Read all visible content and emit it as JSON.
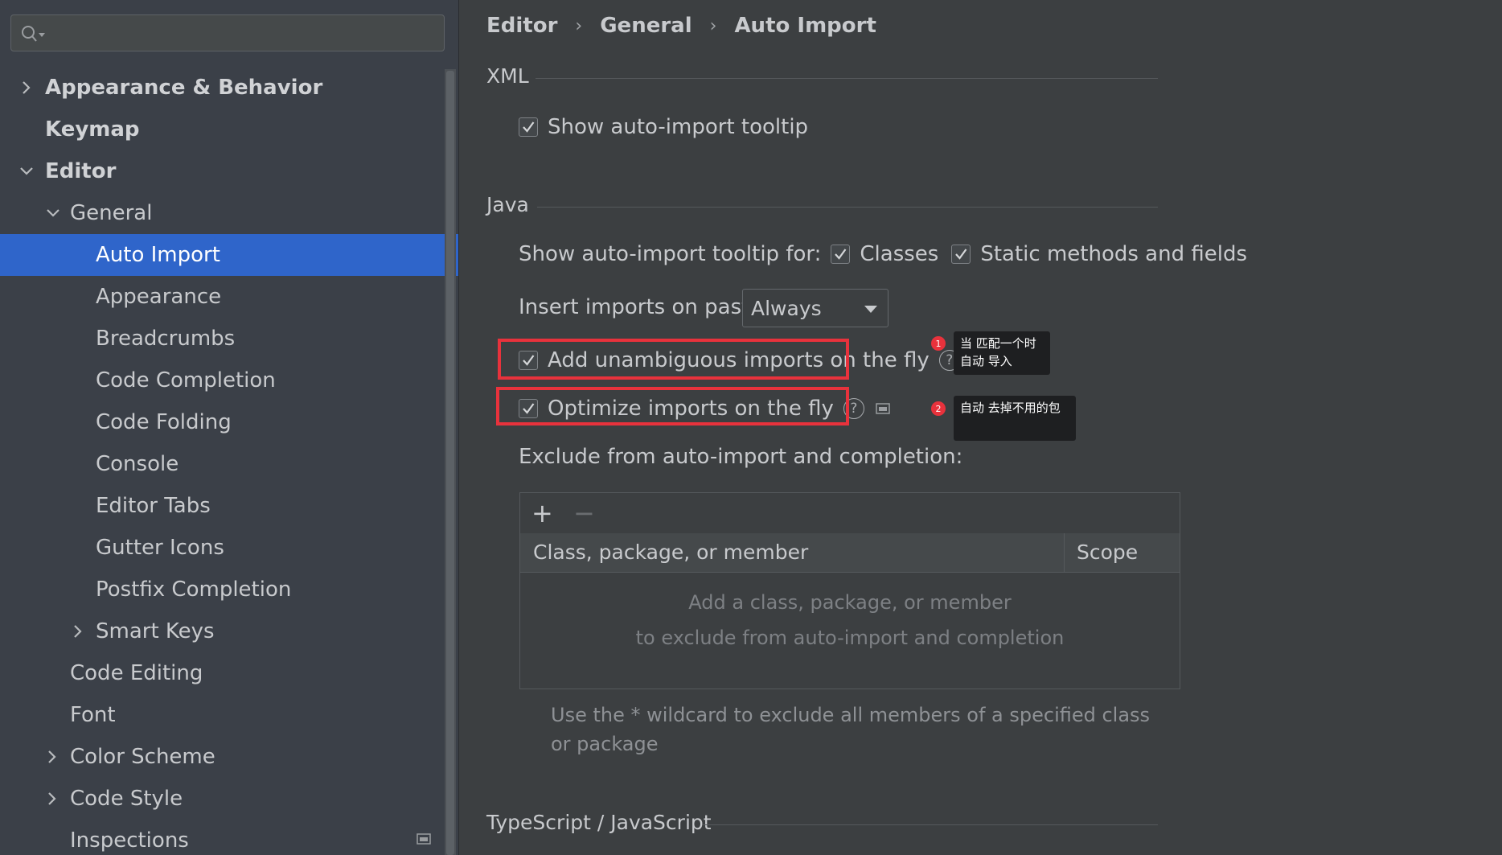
{
  "search": {
    "placeholder": ""
  },
  "sidebar": {
    "items": [
      {
        "label": "Appearance & Behavior"
      },
      {
        "label": "Keymap"
      },
      {
        "label": "Editor"
      },
      {
        "label": "General"
      },
      {
        "label": "Auto Import"
      },
      {
        "label": "Appearance"
      },
      {
        "label": "Breadcrumbs"
      },
      {
        "label": "Code Completion"
      },
      {
        "label": "Code Folding"
      },
      {
        "label": "Console"
      },
      {
        "label": "Editor Tabs"
      },
      {
        "label": "Gutter Icons"
      },
      {
        "label": "Postfix Completion"
      },
      {
        "label": "Smart Keys"
      },
      {
        "label": "Code Editing"
      },
      {
        "label": "Font"
      },
      {
        "label": "Color Scheme"
      },
      {
        "label": "Code Style"
      },
      {
        "label": "Inspections"
      }
    ]
  },
  "breadcrumb": {
    "items": [
      "Editor",
      "General",
      "Auto Import"
    ],
    "separator": "›"
  },
  "xml": {
    "title": "XML",
    "show_tooltip": {
      "label": "Show auto-import tooltip",
      "checked": true
    }
  },
  "java": {
    "title": "Java",
    "tooltip_for_label": "Show auto-import tooltip for:",
    "classes": {
      "label": "Classes",
      "checked": true
    },
    "static_methods": {
      "label": "Static methods and fields",
      "checked": true
    },
    "insert_on_paste_label": "Insert imports on paste:",
    "insert_on_paste_value": "Always",
    "add_unambiguous": {
      "label": "Add unambiguous imports on the fly",
      "checked": true
    },
    "optimize": {
      "label": "Optimize imports on the fly",
      "checked": true
    },
    "exclude_label": "Exclude from auto-import and completion:",
    "table": {
      "add": "+",
      "remove": "−",
      "columns": [
        "Class, package, or member",
        "Scope"
      ],
      "empty_line1": "Add a class, package, or member",
      "empty_line2": "to exclude from auto-import and completion"
    },
    "note": "Use the * wildcard to exclude all members of a specified class or package"
  },
  "typescript": {
    "title": "TypeScript / JavaScript"
  },
  "help": "?",
  "annotations": [
    {
      "number": "1",
      "text_line1": "当 匹配一个时",
      "text_line2": "自动 导入"
    },
    {
      "number": "2",
      "text_line1": "自动 去掉不用的包"
    }
  ],
  "colors": {
    "accent": "#2f65ca",
    "highlight": "#e8323c"
  }
}
